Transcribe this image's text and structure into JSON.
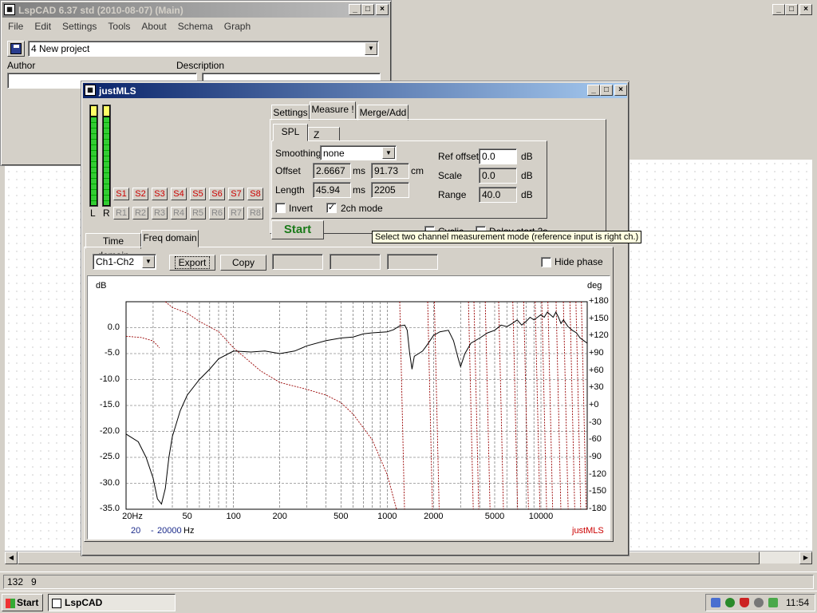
{
  "colors": {
    "accent": "#0a246a",
    "phase": "#990000",
    "spl": "#000000",
    "red_button": "#cc0000"
  },
  "main_window": {
    "title": "LspCAD 6.37  std (2010-08-07) (Main)",
    "menu": [
      "File",
      "Edit",
      "Settings",
      "Tools",
      "About",
      "Schema",
      "Graph"
    ],
    "project": "4 New project",
    "author_label": "Author",
    "description_label": "Description"
  },
  "status": {
    "left": "132",
    "right": "9"
  },
  "taskbar": {
    "start": "Start",
    "task": "LspCAD",
    "clock": "11:54"
  },
  "justmls": {
    "title": "justMLS",
    "meters": {
      "left": "L",
      "right": "R"
    },
    "s_buttons": [
      "S1",
      "S2",
      "S3",
      "S4",
      "S5",
      "S6",
      "S7",
      "S8"
    ],
    "r_buttons": [
      "R1",
      "R2",
      "R3",
      "R4",
      "R5",
      "R6",
      "R7",
      "R8"
    ],
    "tabs": [
      "Settings",
      "Measure !",
      "Merge/Add"
    ],
    "subtabs": [
      "SPL",
      "Z"
    ],
    "smoothing_label": "Smoothing",
    "smoothing": "none",
    "offset_label": "Offset",
    "offset_ms": "2.6667",
    "offset_cm": "91.73",
    "ms_unit": "ms",
    "cm_unit": "cm",
    "length_label": "Length",
    "length_ms": "45.94",
    "length_samples": "2205",
    "invert_label": "Invert",
    "twoch_label": "2ch mode",
    "twoch_checked": "✓",
    "ref_offset_label": "Ref offset",
    "ref_offset": "0.0",
    "scale_label": "Scale",
    "scale": "0.0",
    "range_label": "Range",
    "range": "40.0",
    "db_unit": "dB",
    "start_label": "Start",
    "cyclic_label": "Cyclic",
    "delay_label": "Delay start 2s",
    "tooltip": "Select two channel measurement mode (reference input is right ch.)",
    "domain_tabs": [
      "Time domain",
      "Freq domain"
    ],
    "channel": "Ch1-Ch2",
    "export_label": "Export",
    "copy_label": "Copy",
    "hide_phase_label": "Hide phase"
  },
  "chart_data": {
    "type": "line",
    "ylabel": "dB",
    "y2label": "deg",
    "xscale": "log",
    "xlim": [
      20,
      20000
    ],
    "ylim": [
      -35,
      5
    ],
    "y2lim": [
      -180,
      180
    ],
    "grid": true,
    "y_ticks": [
      "0.0",
      "-5.0",
      "-10.0",
      "-15.0",
      "-20.0",
      "-25.0",
      "-30.0",
      "-35.0"
    ],
    "y2_ticks": [
      "+180",
      "+150",
      "+120",
      "+90",
      "+60",
      "+30",
      "+0",
      "-30",
      "-60",
      "-90",
      "-120",
      "-150",
      "-180"
    ],
    "x_ticks": [
      "20Hz",
      "50",
      "100",
      "200",
      "500",
      "1000",
      "2000",
      "5000",
      "10000"
    ],
    "range_from": "20",
    "range_sep": "-",
    "range_to": "20000",
    "range_unit": "Hz",
    "brand": "justMLS",
    "series": [
      {
        "role": "magnitude",
        "x": [
          20,
          24,
          27,
          30,
          32,
          34,
          36,
          38,
          40,
          45,
          50,
          60,
          70,
          80,
          100,
          130,
          160,
          200,
          250,
          300,
          400,
          500,
          600,
          700,
          800,
          1000,
          1100,
          1200,
          1300,
          1350,
          1400,
          1450,
          1500,
          1600,
          1700,
          1800,
          1900,
          2000,
          2200,
          2500,
          2700,
          2900,
          3000,
          3200,
          3500,
          4000,
          4500,
          5000,
          5500,
          6000,
          6500,
          7000,
          7500,
          8000,
          8500,
          9000,
          9500,
          10000,
          10500,
          11000,
          11500,
          12000,
          12500,
          13000,
          13500,
          14000,
          15000,
          16000,
          17000,
          18000,
          19000,
          20000
        ],
        "y": [
          -20.5,
          -22,
          -25,
          -29,
          -33,
          -34,
          -31,
          -25,
          -21,
          -16,
          -13,
          -10,
          -8,
          -6,
          -4.5,
          -4.7,
          -4.5,
          -5,
          -4.5,
          -3.5,
          -2.5,
          -2,
          -1.8,
          -1.2,
          -1,
          -0.8,
          -0.4,
          0.3,
          0.5,
          -0.5,
          -5,
          -8,
          -5.5,
          -5,
          -4.5,
          -3.5,
          -2.5,
          -1.5,
          -0.8,
          -0.5,
          -2.5,
          -6,
          -7.5,
          -5,
          -3,
          -2,
          -1,
          -0.5,
          0.5,
          0.2,
          0.8,
          1.5,
          0.5,
          1.2,
          2,
          1.5,
          2,
          2.5,
          2,
          3,
          2.5,
          2,
          3,
          2,
          0.8,
          1.5,
          0.2,
          -0.5,
          -1,
          -2,
          -2.5,
          -3
        ]
      },
      {
        "role": "phase",
        "x": [
          20,
          25,
          30,
          33,
          34,
          36,
          40,
          50,
          60,
          80,
          100,
          150,
          200,
          300,
          400,
          500,
          600,
          800,
          1000,
          1150,
          1250
        ],
        "y": [
          120,
          118,
          112,
          100,
          -180,
          180,
          170,
          160,
          146,
          128,
          100,
          60,
          40,
          28,
          18,
          5,
          -15,
          -60,
          -120,
          -180,
          180
        ]
      }
    ],
    "phase_wraps_hz": [
      1250,
      1900,
      2100,
      3500,
      3800,
      4500,
      5500,
      6800,
      8000,
      9500,
      10500,
      11500,
      13000,
      14500,
      16000,
      17500,
      19000
    ]
  }
}
